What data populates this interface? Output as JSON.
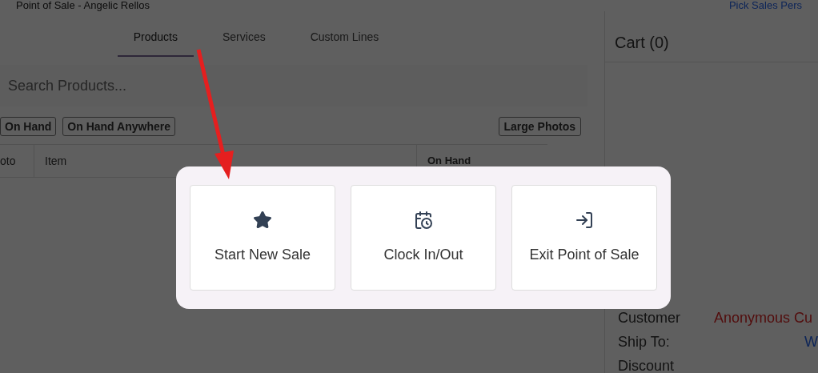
{
  "header": {
    "title": "Point of Sale - Angelic Rellos",
    "salesperson_link": "Pick Sales Pers"
  },
  "tabs": [
    {
      "label": "Products",
      "selected": true
    },
    {
      "label": "Services",
      "selected": false
    },
    {
      "label": "Custom Lines",
      "selected": false
    }
  ],
  "search": {
    "placeholder": "Search Products..."
  },
  "filters": [
    {
      "label": "On Hand"
    },
    {
      "label": "On Hand Anywhere"
    }
  ],
  "view_toggle": "Large Photos",
  "table": {
    "columns": [
      "oto",
      "Item",
      "On Hand"
    ]
  },
  "cart": {
    "title": "Cart (0)",
    "fields": [
      {
        "label": "Customer",
        "value": "Anonymous Cu",
        "kind": "alert"
      },
      {
        "label": "Ship To:",
        "value": "W",
        "kind": "link"
      },
      {
        "label": "Discount"
      }
    ]
  },
  "dialog": {
    "actions": [
      {
        "label": "Start New Sale",
        "kind": "star"
      },
      {
        "label": "Clock In/Out",
        "kind": "clock"
      },
      {
        "label": "Exit Point of Sale",
        "kind": "exit"
      }
    ]
  }
}
